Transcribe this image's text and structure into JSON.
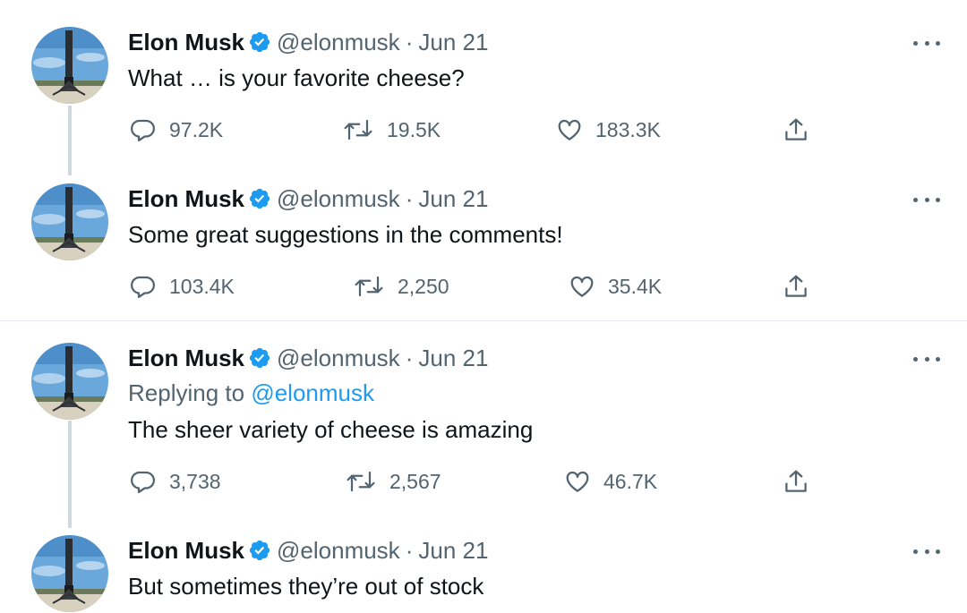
{
  "author": {
    "name": "Elon Musk",
    "handle": "@elonmusk",
    "verified_icon": "verified-badge-icon",
    "avatar_icon": "rocket-avatar-icon"
  },
  "separator": "·",
  "colors": {
    "text_primary": "#0f1419",
    "text_secondary": "#536471",
    "accent": "#1d9bf0",
    "thread_line": "#cfd9de"
  },
  "icons": {
    "reply": "reply-icon",
    "retweet": "retweet-icon",
    "like": "heart-icon",
    "share": "share-icon",
    "more": "more-icon"
  },
  "tweets": [
    {
      "date": "Jun 21",
      "text": "What … is your favorite cheese?",
      "replies": "97.2K",
      "retweets": "19.5K",
      "likes": "183.3K"
    },
    {
      "date": "Jun 21",
      "text": "Some great suggestions in the comments!",
      "replies": "103.4K",
      "retweets": "2,250",
      "likes": "35.4K"
    },
    {
      "date": "Jun 21",
      "replying_to_label": "Replying to",
      "replying_to_handle": "@elonmusk",
      "text": "The sheer variety of cheese is amazing",
      "replies": "3,738",
      "retweets": "2,567",
      "likes": "46.7K"
    },
    {
      "date": "Jun 21",
      "text": "But sometimes they’re out of stock"
    }
  ]
}
